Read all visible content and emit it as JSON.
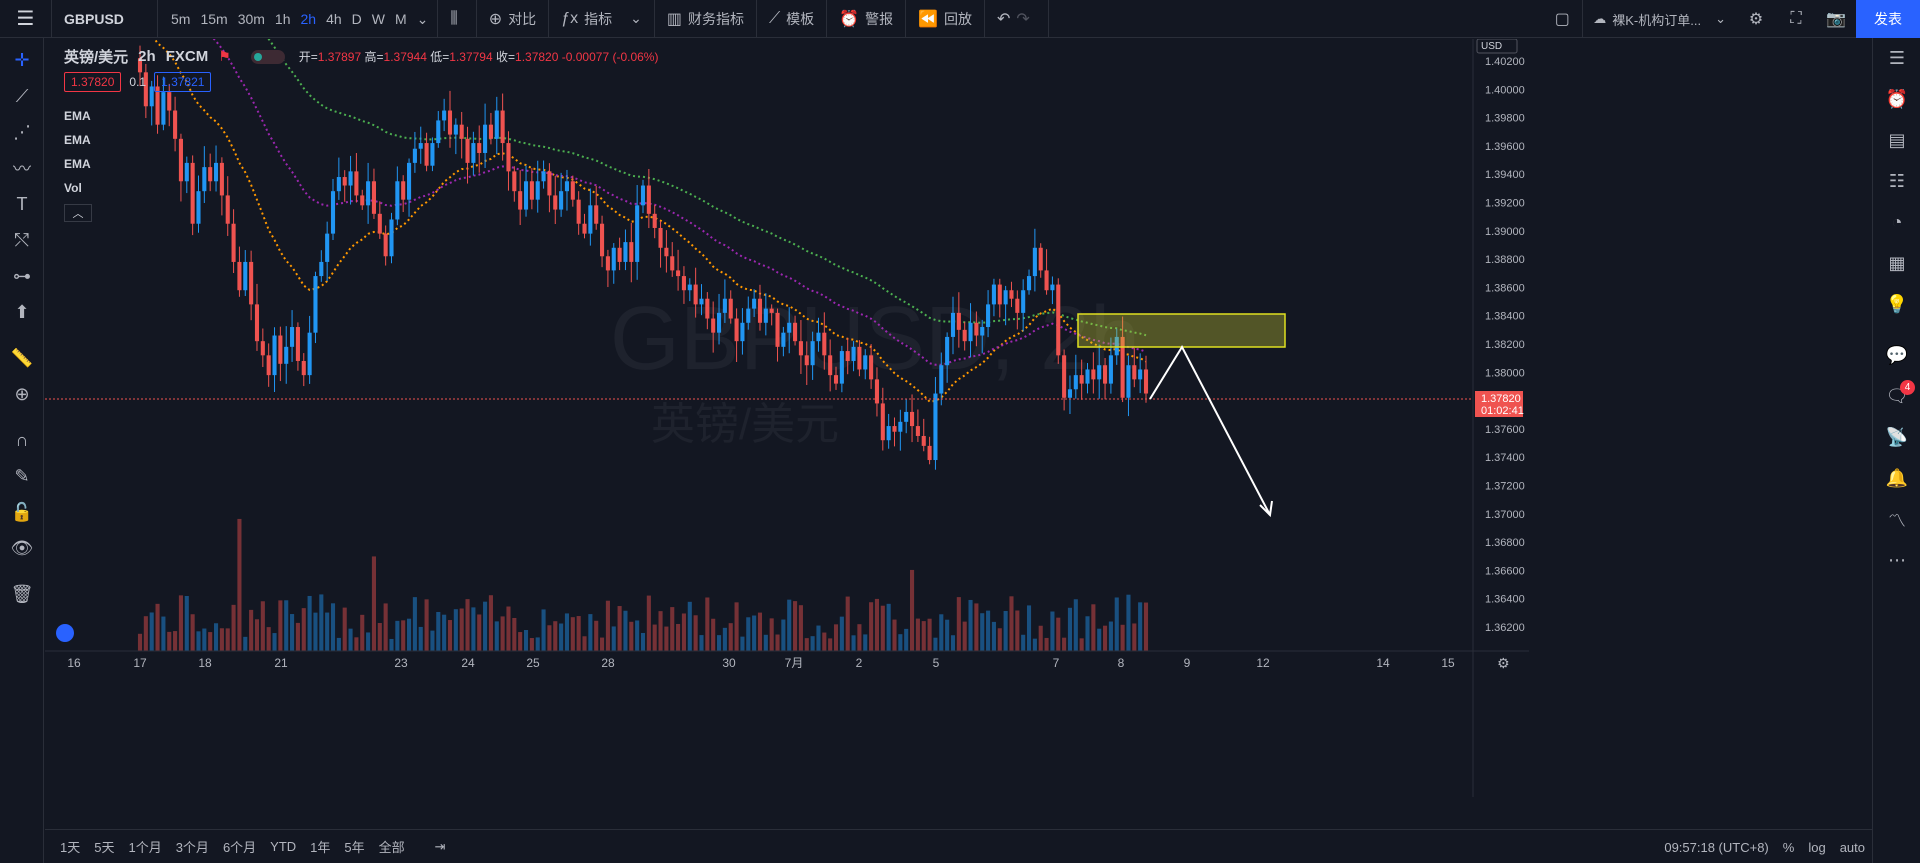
{
  "toolbar": {
    "symbol": "GBPUSD",
    "intervals": [
      "5m",
      "15m",
      "30m",
      "1h",
      "2h",
      "4h",
      "D",
      "W",
      "M"
    ],
    "active_interval": "2h",
    "compare_label": "对比",
    "indicators_label": "指标",
    "financials_label": "财务指标",
    "templates_label": "模板",
    "alert_label": "警报",
    "replay_label": "回放",
    "layout_name": "裸K-机构订单...",
    "publish_label": "发表"
  },
  "legend": {
    "title": "英镑/美元",
    "interval": "2h",
    "exchange": "FXCM",
    "open_label": "开=",
    "open": "1.37897",
    "high_label": "高=",
    "high": "1.37944",
    "low_label": "低=",
    "low": "1.37794",
    "close_label": "收=",
    "close": "1.37820",
    "change": "-0.00077 (-0.06%)",
    "bid": "1.37820",
    "spread": "0.1",
    "ask": "1.37821",
    "indicators": [
      "EMA",
      "EMA",
      "EMA",
      "Vol"
    ]
  },
  "watermark": {
    "symbol": "GBPUSD, 2h",
    "description": "英镑/美元"
  },
  "price_axis": {
    "currency": "USD",
    "ticks": [
      "1.40200",
      "1.40000",
      "1.39800",
      "1.39600",
      "1.39400",
      "1.39200",
      "1.39000",
      "1.38800",
      "1.38600",
      "1.38400",
      "1.38200",
      "1.38000",
      "1.37600",
      "1.37400",
      "1.37200",
      "1.37000",
      "1.36800",
      "1.36600",
      "1.36400",
      "1.36200"
    ],
    "current_price": "1.37820",
    "countdown": "01:02:41"
  },
  "time_axis": {
    "ticks": [
      "16",
      "17",
      "18",
      "21",
      "23",
      "24",
      "25",
      "28",
      "30",
      "7月",
      "2",
      "5",
      "7",
      "8",
      "9",
      "12",
      "14",
      "15"
    ]
  },
  "bottom": {
    "ranges": [
      "1天",
      "5天",
      "1个月",
      "3个月",
      "6个月",
      "YTD",
      "1年",
      "5年",
      "全部"
    ],
    "clock": "09:57:18 (UTC+8)",
    "percent_label": "%",
    "log_label": "log",
    "auto_label": "auto"
  },
  "right_sidebar": {
    "notification_count": "4"
  },
  "colors": {
    "up": "#2196f3",
    "down": "#ef5350",
    "ema_fast": "#ff9800",
    "ema_mid": "#9c27b0",
    "ema_slow": "#4caf50",
    "zone": "#c8c832",
    "accent": "#2962ff"
  }
}
